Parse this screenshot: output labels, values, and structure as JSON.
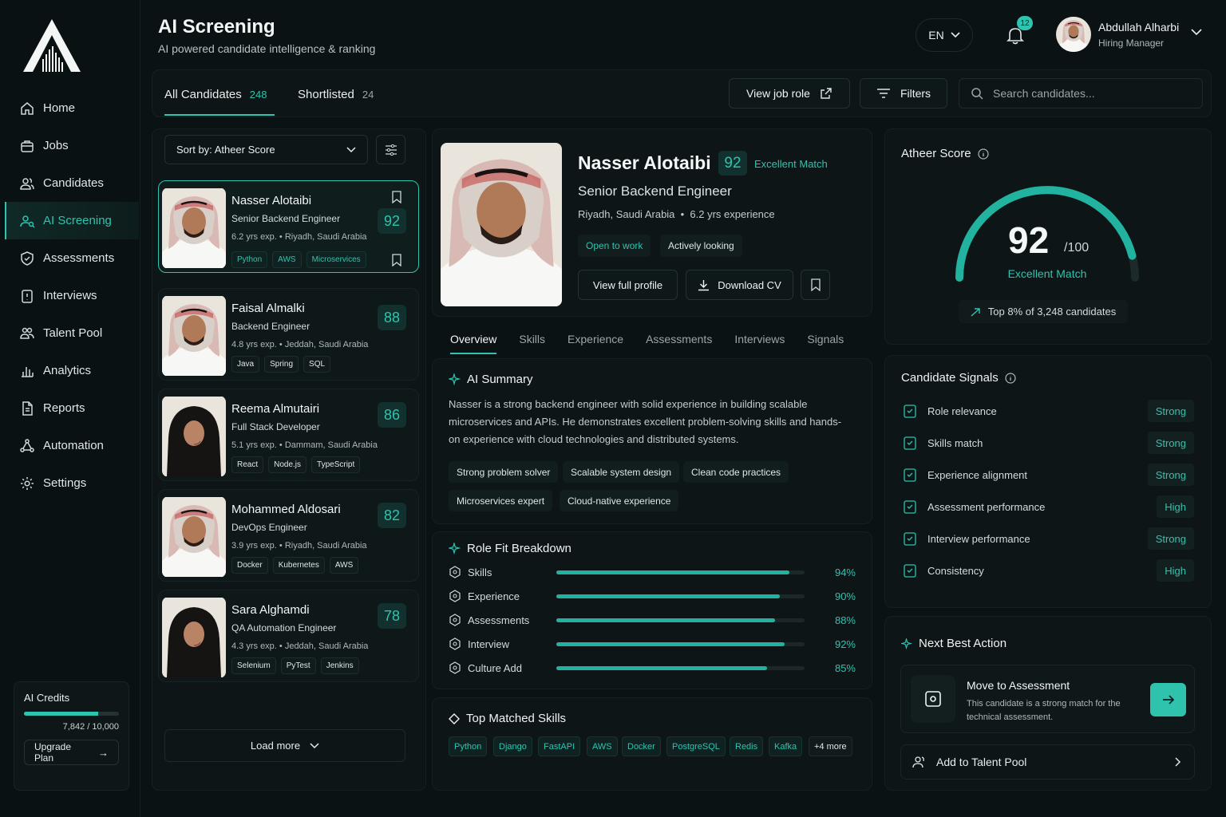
{
  "nav": {
    "items": [
      {
        "label": "Home",
        "icon": "home-icon"
      },
      {
        "label": "Jobs",
        "icon": "briefcase-icon"
      },
      {
        "label": "Candidates",
        "icon": "users-icon"
      },
      {
        "label": "AI Screening",
        "icon": "user-search-icon",
        "active": true
      },
      {
        "label": "Assessments",
        "icon": "shield-check-icon"
      },
      {
        "label": "Interviews",
        "icon": "clipboard-icon"
      },
      {
        "label": "Talent Pool",
        "icon": "users-group-icon"
      },
      {
        "label": "Analytics",
        "icon": "bar-chart-icon"
      },
      {
        "label": "Reports",
        "icon": "document-icon"
      },
      {
        "label": "Automation",
        "icon": "flow-icon"
      },
      {
        "label": "Settings",
        "icon": "gear-icon"
      }
    ]
  },
  "credits": {
    "title": "AI Credits",
    "used": "7,842",
    "total": "10,000",
    "display": "7,842 / 10,000",
    "fraction": 0.7842,
    "upgrade_label": "Upgrade Plan"
  },
  "header": {
    "title": "AI Screening",
    "subtitle": "AI powered candidate intelligence & ranking",
    "language": "EN",
    "notifications_count": "12"
  },
  "user": {
    "name": "Abdullah Alharbi",
    "role": "Hiring Manager"
  },
  "tabs": [
    {
      "label": "All Candidates",
      "count": "248"
    },
    {
      "label": "Shortlisted",
      "count": "24"
    }
  ],
  "toolbar": {
    "view_job_role": "View job role",
    "filters": "Filters",
    "search_placeholder": "Search candidates..."
  },
  "list": {
    "sort_label": "Sort by: Atheer Score",
    "load_more": "Load more",
    "candidates": [
      {
        "name": "Nasser Alotaibi",
        "role": "Senior Backend Engineer",
        "meta": "6.2 yrs exp.  •  Riyadh, Saudi Arabia",
        "score": "92",
        "tags": [
          "Python",
          "AWS",
          "Microservices"
        ]
      },
      {
        "name": "Faisal Almalki",
        "role": "Backend Engineer",
        "meta": "4.8 yrs exp.  •  Jeddah, Saudi Arabia",
        "score": "88",
        "tags": [
          "Java",
          "Spring",
          "SQL"
        ]
      },
      {
        "name": "Reema Almutairi",
        "role": "Full Stack Developer",
        "meta": "5.1 yrs exp.  •  Dammam, Saudi Arabia",
        "score": "86",
        "tags": [
          "React",
          "Node.js",
          "TypeScript"
        ]
      },
      {
        "name": "Mohammed Aldosari",
        "role": "DevOps Engineer",
        "meta": "3.9 yrs exp.  •  Riyadh, Saudi Arabia",
        "score": "82",
        "tags": [
          "Docker",
          "Kubernetes",
          "AWS"
        ]
      },
      {
        "name": "Sara Alghamdi",
        "role": "QA Automation Engineer",
        "meta": "4.3 yrs exp.  •  Jeddah, Saudi Arabia",
        "score": "78",
        "tags": [
          "Selenium",
          "PyTest",
          "Jenkins"
        ]
      }
    ]
  },
  "detail": {
    "name": "Nasser Alotaibi",
    "score": "92",
    "match": "Excellent Match",
    "role": "Senior Backend Engineer",
    "location": "Riyadh, Saudi Arabia",
    "experience": "6.2 yrs experience",
    "status_pills": [
      "Open to work",
      "Actively looking"
    ],
    "view_profile": "View full profile",
    "download_cv": "Download CV",
    "tabs": [
      "Overview",
      "Skills",
      "Experience",
      "Assessments",
      "Interviews",
      "Signals"
    ],
    "summary_title": "AI Summary",
    "summary": "Nasser is a strong backend engineer with solid experience in building scalable microservices and APIs. He demonstrates excellent problem-solving skills and hands-on experience with cloud technologies and distributed systems.",
    "summary_chips": [
      "Strong problem solver",
      "Scalable system design",
      "Clean code practices",
      "Microservices expert",
      "Cloud-native experience"
    ],
    "fit_title": "Role Fit Breakdown",
    "fit": [
      {
        "label": "Skills",
        "value": 94,
        "display": "94%"
      },
      {
        "label": "Experience",
        "value": 90,
        "display": "90%"
      },
      {
        "label": "Assessments",
        "value": 88,
        "display": "88%"
      },
      {
        "label": "Interview",
        "value": 92,
        "display": "92%"
      },
      {
        "label": "Culture Add",
        "value": 85,
        "display": "85%"
      }
    ],
    "skills_title": "Top Matched Skills",
    "skills": [
      "Python",
      "Django",
      "FastAPI",
      "AWS",
      "Docker",
      "PostgreSQL",
      "Redis",
      "Kafka"
    ],
    "skills_more": "+4 more"
  },
  "atheer": {
    "title": "Atheer Score",
    "score": "92",
    "score_value": 92,
    "max": "/100",
    "label": "Excellent Match",
    "rank": "Top 8% of 3,248 candidates"
  },
  "signals": {
    "title": "Candidate Signals",
    "items": [
      {
        "label": "Role relevance",
        "value": "Strong"
      },
      {
        "label": "Skills match",
        "value": "Strong"
      },
      {
        "label": "Experience alignment",
        "value": "Strong"
      },
      {
        "label": "Assessment performance",
        "value": "High"
      },
      {
        "label": "Interview performance",
        "value": "Strong"
      },
      {
        "label": "Consistency",
        "value": "High"
      }
    ]
  },
  "next_action": {
    "title": "Next Best Action",
    "action_title": "Move to Assessment",
    "action_desc": "This candidate is a strong match for the technical assessment.",
    "talent_pool": "Add to Talent Pool"
  },
  "colors": {
    "accent": "#2ec4b0",
    "background": "#0b1213",
    "panel": "#0d1516"
  }
}
